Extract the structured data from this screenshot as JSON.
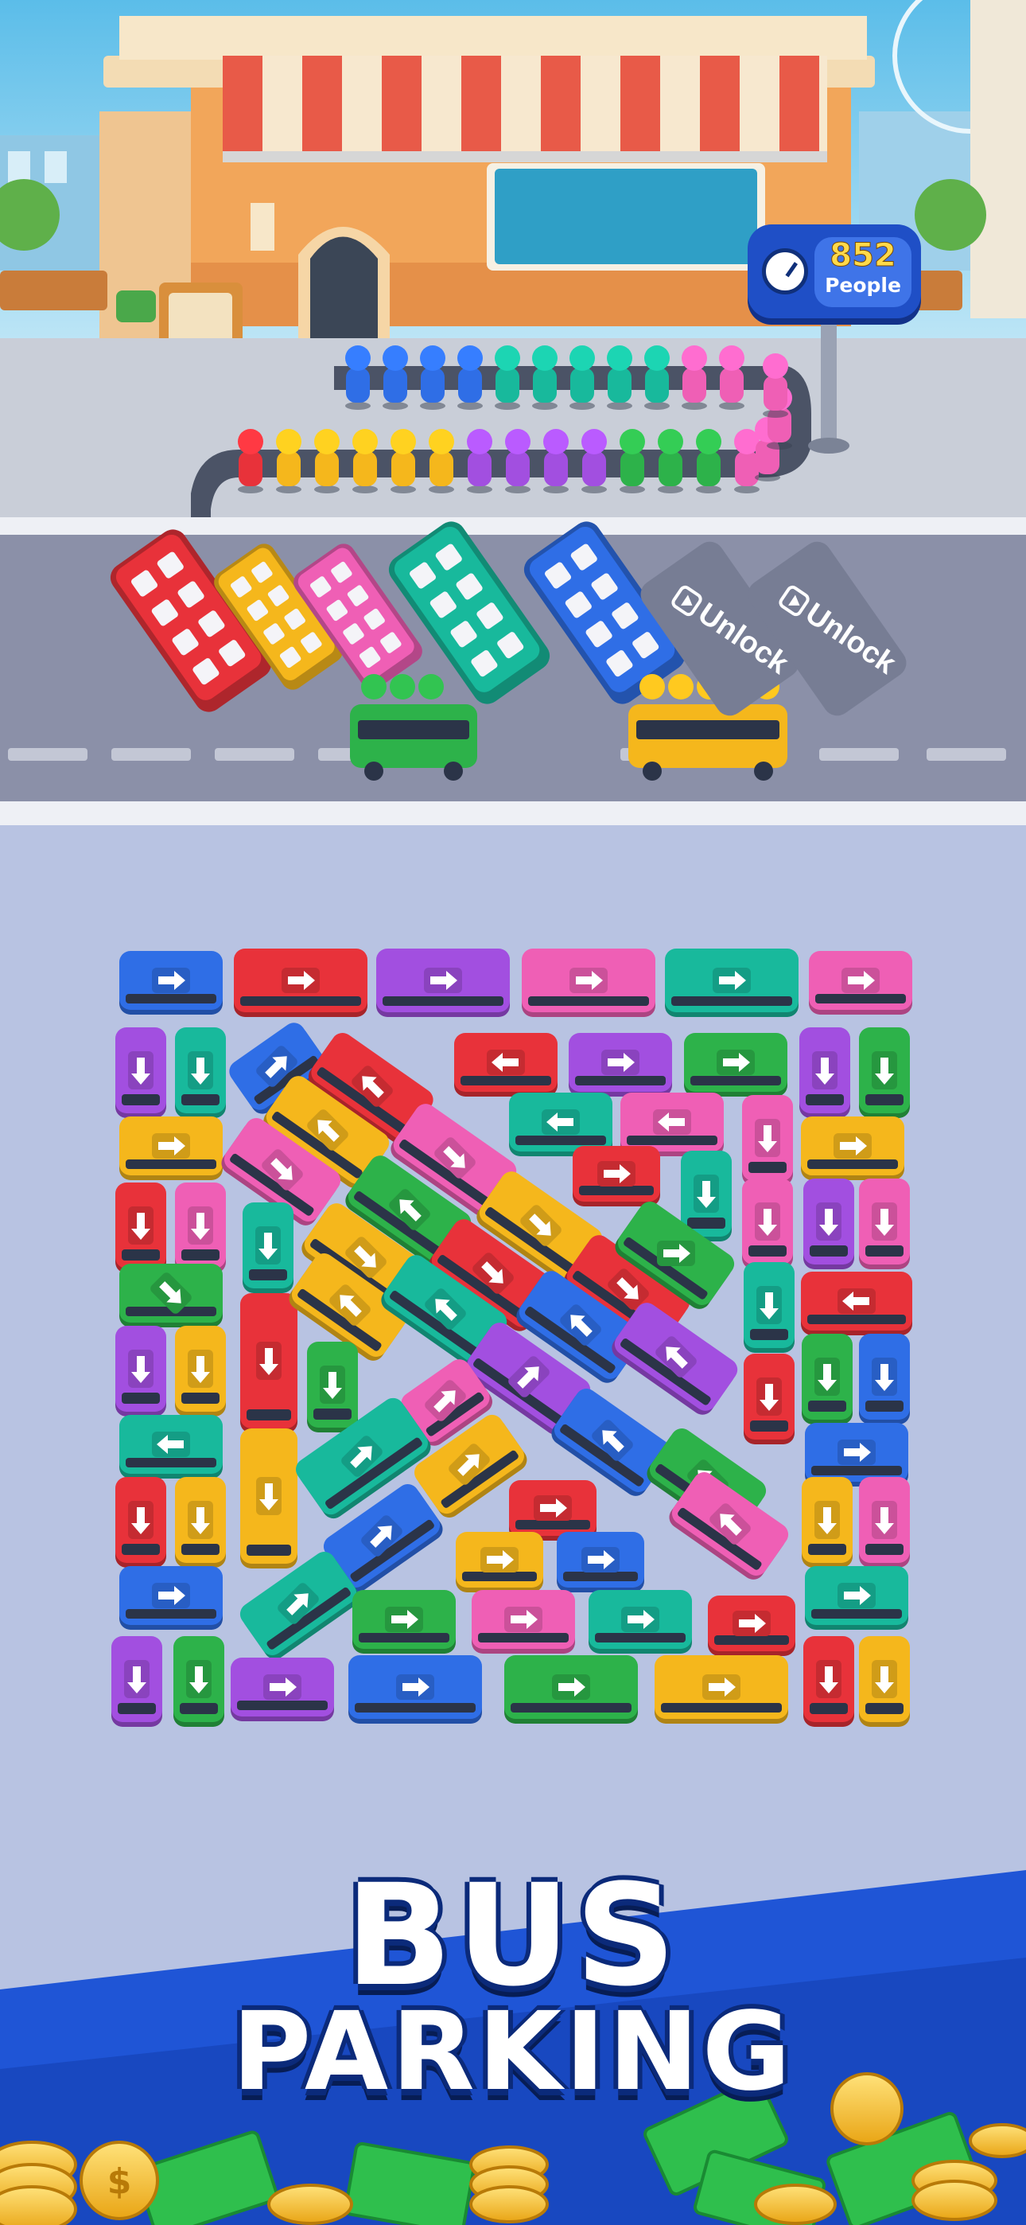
{
  "counter": {
    "value": "852",
    "label": "People"
  },
  "slots": [
    {
      "label": "Unlock",
      "icon": "video-play-icon"
    },
    {
      "label": "Unlock",
      "icon": "video-play-icon"
    }
  ],
  "title": {
    "line1": "BUS",
    "line2": "PARKING"
  },
  "colors": {
    "red": "#e8323a",
    "yellow": "#f5b71c",
    "pink": "#ef5fb5",
    "teal": "#18b99c",
    "blue": "#2f6ee6",
    "purple": "#a24fe0",
    "green": "#2db24a",
    "board": "#b8c3e2",
    "road": "#8b90a8",
    "banner": "#1f55d6"
  },
  "queue_colors": [
    "red",
    "yellow",
    "yellow",
    "yellow",
    "yellow",
    "yellow",
    "purple",
    "purple",
    "purple",
    "purple",
    "green",
    "green",
    "green",
    "pink",
    "pink",
    "pink",
    "pink",
    "pink",
    "pink",
    "teal",
    "teal",
    "teal",
    "teal",
    "teal",
    "blue",
    "blue",
    "blue",
    "blue"
  ],
  "parked_buses": [
    "red",
    "yellow",
    "pink",
    "teal",
    "blue"
  ],
  "moving_buses": [
    "green",
    "yellow"
  ],
  "vehicles": [
    [
      "blue",
      "right"
    ],
    [
      "red",
      "right"
    ],
    [
      "purple",
      "right"
    ],
    [
      "pink",
      "right"
    ],
    [
      "teal",
      "right"
    ],
    [
      "pink",
      "right"
    ],
    [
      "purple",
      "down"
    ],
    [
      "teal",
      "down"
    ],
    [
      "blue",
      "up-right"
    ],
    [
      "red",
      "up-left"
    ],
    [
      "red",
      "left"
    ],
    [
      "purple",
      "right"
    ],
    [
      "green",
      "right"
    ],
    [
      "purple",
      "down"
    ],
    [
      "green",
      "down"
    ],
    [
      "yellow",
      "right"
    ],
    [
      "yellow",
      "up-left"
    ],
    [
      "teal",
      "left"
    ],
    [
      "pink",
      "left"
    ],
    [
      "pink",
      "down"
    ],
    [
      "yellow",
      "right"
    ],
    [
      "red",
      "down"
    ],
    [
      "pink",
      "down"
    ],
    [
      "pink",
      "down-right"
    ],
    [
      "pink",
      "down-right"
    ],
    [
      "red",
      "right"
    ],
    [
      "teal",
      "down"
    ],
    [
      "pink",
      "down"
    ],
    [
      "purple",
      "down"
    ],
    [
      "pink",
      "down"
    ],
    [
      "teal",
      "down"
    ],
    [
      "green",
      "down-right"
    ],
    [
      "green",
      "up-left"
    ],
    [
      "yellow",
      "down-right"
    ],
    [
      "yellow",
      "down-right"
    ],
    [
      "red",
      "down-right"
    ],
    [
      "red",
      "down-right"
    ],
    [
      "green",
      "right"
    ],
    [
      "teal",
      "down"
    ],
    [
      "red",
      "left"
    ],
    [
      "purple",
      "down"
    ],
    [
      "yellow",
      "down"
    ],
    [
      "red",
      "down"
    ],
    [
      "yellow",
      "up-left"
    ],
    [
      "teal",
      "up-left"
    ],
    [
      "blue",
      "up-left"
    ],
    [
      "purple",
      "up-right"
    ],
    [
      "purple",
      "up-left"
    ],
    [
      "green",
      "down"
    ],
    [
      "blue",
      "down"
    ],
    [
      "red",
      "down"
    ],
    [
      "teal",
      "left"
    ],
    [
      "green",
      "down"
    ],
    [
      "pink",
      "up-right"
    ],
    [
      "blue",
      "up-left"
    ],
    [
      "green",
      "up-left"
    ],
    [
      "blue",
      "right"
    ],
    [
      "red",
      "down"
    ],
    [
      "yellow",
      "down"
    ],
    [
      "yellow",
      "down"
    ],
    [
      "teal",
      "up-right"
    ],
    [
      "yellow",
      "up-right"
    ],
    [
      "red",
      "right"
    ],
    [
      "pink",
      "up-left"
    ],
    [
      "yellow",
      "down"
    ],
    [
      "pink",
      "down"
    ],
    [
      "blue",
      "right"
    ],
    [
      "blue",
      "up-right"
    ],
    [
      "yellow",
      "right"
    ],
    [
      "blue",
      "right"
    ],
    [
      "teal",
      "right"
    ],
    [
      "teal",
      "up-right"
    ],
    [
      "green",
      "right"
    ],
    [
      "pink",
      "right"
    ],
    [
      "teal",
      "right"
    ],
    [
      "red",
      "right"
    ],
    [
      "purple",
      "down"
    ],
    [
      "green",
      "down"
    ],
    [
      "purple",
      "right"
    ],
    [
      "blue",
      "right"
    ],
    [
      "green",
      "right"
    ],
    [
      "yellow",
      "right"
    ],
    [
      "red",
      "down"
    ],
    [
      "yellow",
      "down"
    ]
  ]
}
